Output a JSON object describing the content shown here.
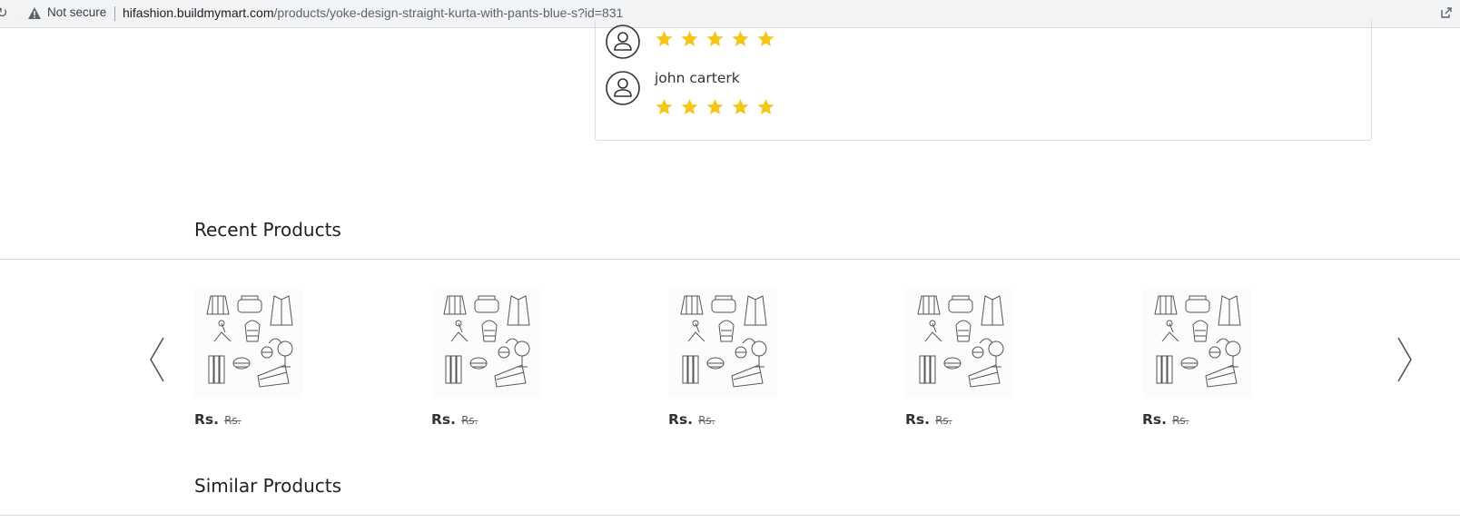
{
  "browser": {
    "security_label": "Not secure",
    "url_host": "hifashion.buildmymart.com",
    "url_path": "/products/yoke-design-straight-kurta-with-pants-blue-s?id=831",
    "icons": [
      "reload-icon",
      "warning-triangle-icon",
      "open-external-icon"
    ]
  },
  "reviews": {
    "items": [
      {
        "name": "",
        "rating": 5
      },
      {
        "name": "john carterk",
        "rating": 5
      }
    ],
    "star_color": "#f5c518"
  },
  "recent_products": {
    "title": "Recent Products",
    "items": [
      {
        "image": "placeholder-illustration",
        "price": "Rs.",
        "old_price": "Rs."
      },
      {
        "image": "placeholder-illustration",
        "price": "Rs.",
        "old_price": "Rs."
      },
      {
        "image": "placeholder-illustration",
        "price": "Rs.",
        "old_price": "Rs."
      },
      {
        "image": "placeholder-illustration",
        "price": "Rs.",
        "old_price": "Rs."
      },
      {
        "image": "placeholder-illustration",
        "price": "Rs.",
        "old_price": "Rs."
      }
    ],
    "prev_icon": "chevron-left-icon",
    "next_icon": "chevron-right-icon"
  },
  "similar_products": {
    "title": "Similar Products"
  }
}
